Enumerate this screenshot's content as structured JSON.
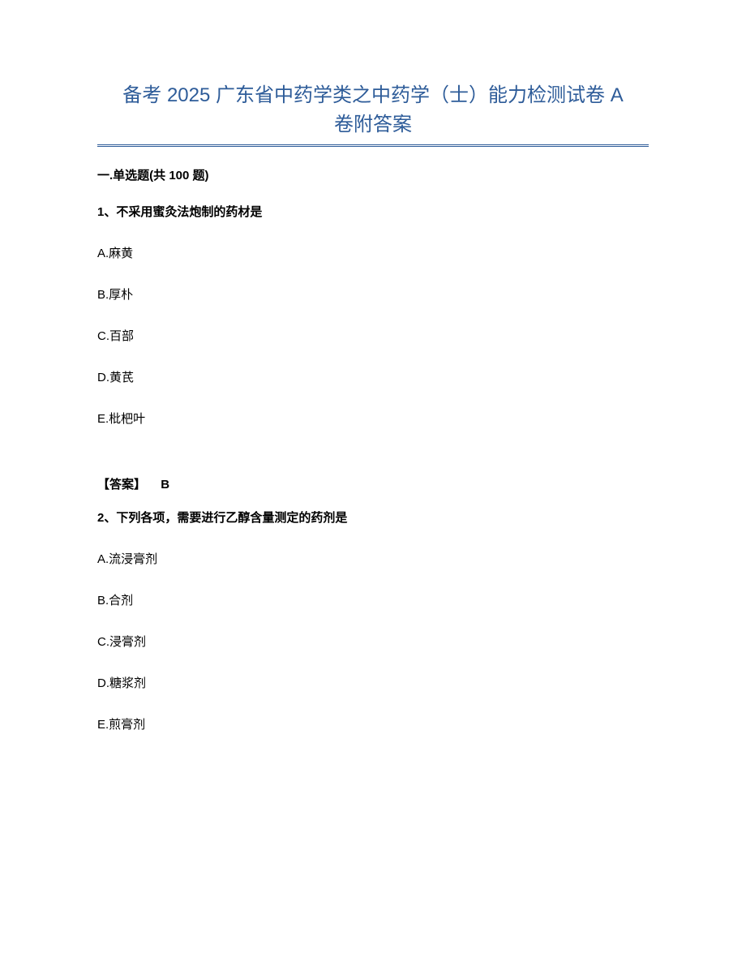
{
  "title_line1": "备考 2025 广东省中药学类之中药学（士）能力检测试卷 A",
  "title_line2": "卷附答案",
  "section_heading": "一.单选题(共 100 题)",
  "questions": [
    {
      "stem": "1、不采用蜜灸法炮制的药材是",
      "options": {
        "A": "A.麻黄",
        "B": "B.厚朴",
        "C": "C.百部",
        "D": "D.黄芪",
        "E": "E.枇杷叶"
      },
      "answer_label": "【答案】",
      "answer_value": "B"
    },
    {
      "stem": "2、下列各项，需要进行乙醇含量测定的药剂是",
      "options": {
        "A": "A.流浸膏剂",
        "B": "B.合剂",
        "C": "C.浸膏剂",
        "D": "D.糖浆剂",
        "E": "E.煎膏剂"
      }
    }
  ]
}
